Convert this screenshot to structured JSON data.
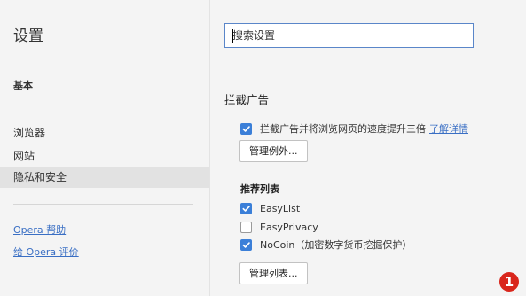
{
  "sidebar": {
    "title": "设置",
    "items": [
      {
        "label": "基本"
      },
      {
        "label": "浏览器"
      },
      {
        "label": "网站"
      },
      {
        "label": "隐私和安全"
      }
    ],
    "links": [
      {
        "label": "Opera 帮助"
      },
      {
        "label": "给 Opera 评价"
      }
    ]
  },
  "search": {
    "placeholder": "搜索设置"
  },
  "ad_block": {
    "title": "拦截广告",
    "main_toggle": {
      "label": "拦截广告并将浏览网页的速度提升三倍",
      "checked": true,
      "link": "了解详情"
    },
    "exceptions_button": "管理例外...",
    "lists_title": "推荐列表",
    "lists": [
      {
        "label": "EasyList",
        "checked": true
      },
      {
        "label": "EasyPrivacy",
        "checked": false
      },
      {
        "label": "NoCoin（加密数字货币挖掘保护）",
        "checked": true
      }
    ],
    "manage_lists_button": "管理列表..."
  },
  "annotation": {
    "marker": "1",
    "color": "#d9261c"
  },
  "colors": {
    "accent": "#3b7fd8",
    "link": "#3a6fc4"
  }
}
